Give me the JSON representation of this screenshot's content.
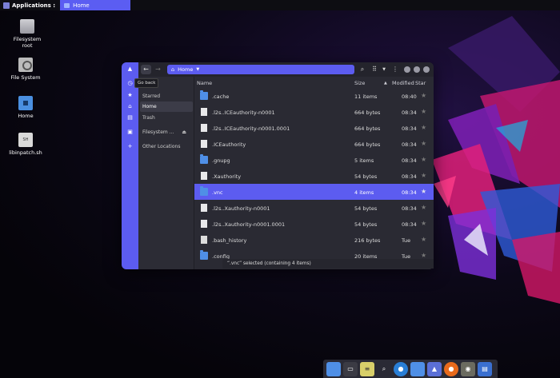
{
  "top_panel": {
    "applications_label": "Applications :",
    "task_home_label": "Home"
  },
  "desktop": {
    "icons": [
      {
        "label": "Filesystem root",
        "icon": "drive-icon"
      },
      {
        "label": "File System",
        "icon": "disk-icon"
      },
      {
        "label": "Home",
        "icon": "home-folder-icon"
      },
      {
        "label": "libinpatch.sh",
        "icon": "script-icon"
      }
    ]
  },
  "window": {
    "path": "Home",
    "tooltip": "Go back",
    "sidebar": [
      {
        "label": "Starred",
        "icon": "star-icon"
      },
      {
        "label": "Home",
        "icon": "home-icon",
        "active": true
      },
      {
        "label": "Trash",
        "icon": "trash-icon"
      },
      {
        "label": "Filesystem ...",
        "icon": "drive-icon"
      },
      {
        "label": "Other Locations",
        "icon": "plus-icon"
      }
    ],
    "columns": {
      "name": "Name",
      "size": "Size",
      "modified": "Modified",
      "star": "Star"
    },
    "files": [
      {
        "name": ".cache",
        "size": "11 items",
        "modified": "08:40",
        "type": "folder"
      },
      {
        "name": ".l2s..ICEauthority-n0001",
        "size": "664 bytes",
        "modified": "08:34",
        "type": "file"
      },
      {
        "name": ".l2s..ICEauthority-n0001.0001",
        "size": "664 bytes",
        "modified": "08:34",
        "type": "file"
      },
      {
        "name": ".ICEauthority",
        "size": "664 bytes",
        "modified": "08:34",
        "type": "file"
      },
      {
        "name": ".gnupg",
        "size": "5 items",
        "modified": "08:34",
        "type": "folder"
      },
      {
        "name": ".Xauthority",
        "size": "54 bytes",
        "modified": "08:34",
        "type": "file"
      },
      {
        "name": ".vnc",
        "size": "4 items",
        "modified": "08:34",
        "type": "folder",
        "selected": true
      },
      {
        "name": ".l2s..Xauthority-n0001",
        "size": "54 bytes",
        "modified": "08:34",
        "type": "file"
      },
      {
        "name": ".l2s..Xauthority-n0001.0001",
        "size": "54 bytes",
        "modified": "08:34",
        "type": "file"
      },
      {
        "name": ".bash_history",
        "size": "216 bytes",
        "modified": "Tue",
        "type": "text"
      },
      {
        "name": ".config",
        "size": "20 items",
        "modified": "Tue",
        "type": "folder"
      }
    ],
    "status": "“.vnc” selected (containing 4 items)"
  },
  "dock": {
    "items": [
      "files-icon",
      "terminal-icon",
      "notes-icon",
      "search-icon",
      "chromium-icon",
      "folder-icon",
      "app-icon",
      "firefox-icon",
      "gimp-icon",
      "editor-icon"
    ]
  },
  "colors": {
    "accent": "#5c5cf0",
    "window_bg": "#2a2a33",
    "folder": "#4f8fe6"
  }
}
